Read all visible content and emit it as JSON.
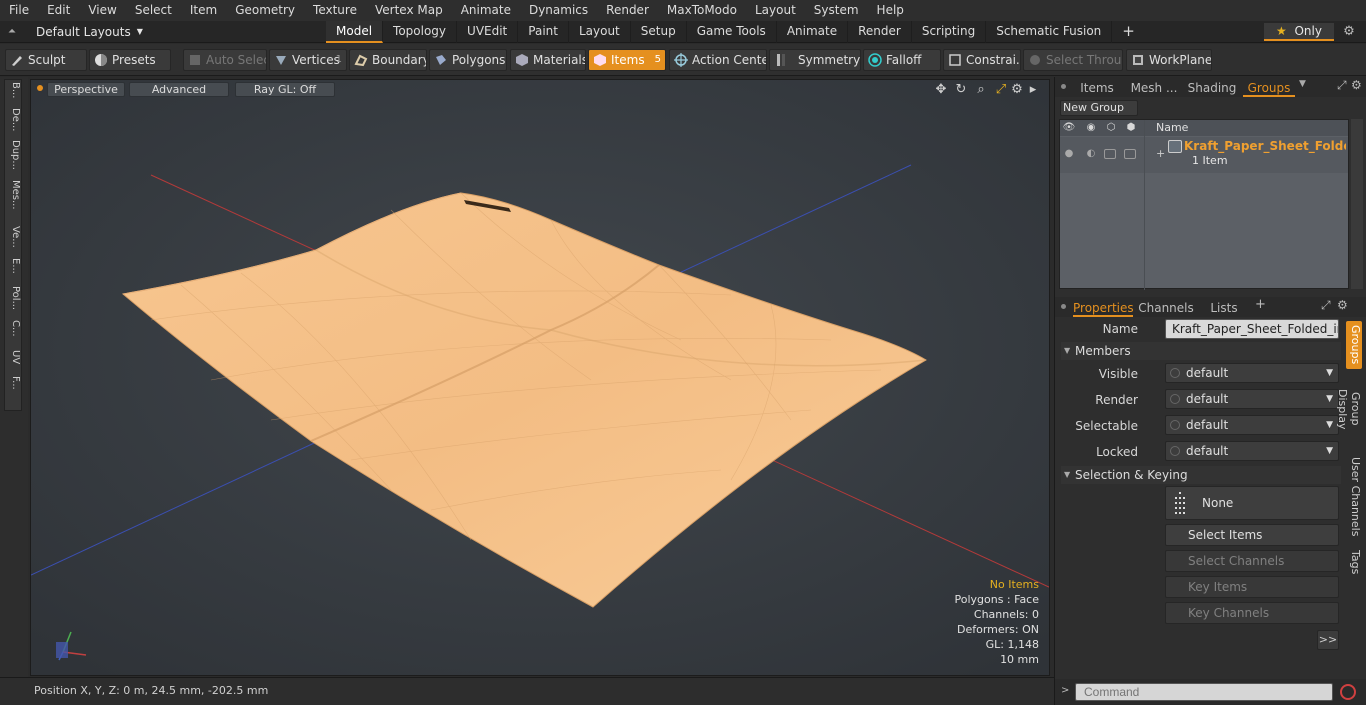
{
  "menu": [
    "File",
    "Edit",
    "View",
    "Select",
    "Item",
    "Geometry",
    "Texture",
    "Vertex Map",
    "Animate",
    "Dynamics",
    "Render",
    "MaxToModo",
    "Layout",
    "System",
    "Help"
  ],
  "layout_select": "Default Layouts",
  "layout_tabs": [
    "Model",
    "Topology",
    "UVEdit",
    "Paint",
    "Layout",
    "Setup",
    "Game Tools",
    "Animate",
    "Render",
    "Scripting",
    "Schematic Fusion"
  ],
  "layout_active": "Model",
  "add_tab": "+",
  "only_label": "Only",
  "toolbar": {
    "sculpt": "Sculpt",
    "presets": "Presets",
    "auto_select": "Auto Select",
    "vertices": "Vertices",
    "vertices_count": "1",
    "boundary": "Boundary",
    "polygons": "Polygons",
    "materials": "Materials",
    "items": "Items",
    "items_count": "5",
    "action_center": "Action Center",
    "symmetry": "Symmetry",
    "falloff": "Falloff",
    "constraints": "Constrai...",
    "select_through": "Select Through",
    "workplane": "WorkPlane"
  },
  "left_tabs": [
    "B...",
    "De...",
    "Dup...",
    "Mes...",
    "Ve...",
    "E...",
    "Pol...",
    "C...",
    "UV",
    "F..."
  ],
  "viewport": {
    "perspective": "Perspective",
    "advanced": "Advanced",
    "raygl": "Ray GL: Off",
    "stats": {
      "no_items": "No Items",
      "polygons": "Polygons : Face",
      "channels": "Channels: 0",
      "deformers": "Deformers: ON",
      "gl": "GL: 1,148",
      "scale": "10 mm"
    }
  },
  "status": {
    "position": "Position X, Y, Z:   0 m, 24.5 mm, -202.5 mm"
  },
  "right_top_tabs": [
    "Items",
    "Mesh ...",
    "Shading",
    "Groups"
  ],
  "right_top_active": "Groups",
  "new_group": "New Group",
  "groups_table": {
    "name_header": "Name",
    "group_name": "Kraft_Paper_Sheet_Folde ...",
    "group_count": "1 Item"
  },
  "props_tabs": [
    "Properties",
    "Channels",
    "Lists"
  ],
  "props_active": "Properties",
  "props": {
    "name_label": "Name",
    "name_value": "Kraft_Paper_Sheet_Folded_in_Fc",
    "members_section": "Members",
    "visible_label": "Visible",
    "visible_value": "default",
    "render_label": "Render",
    "render_value": "default",
    "selectable_label": "Selectable",
    "selectable_value": "default",
    "locked_label": "Locked",
    "locked_value": "default",
    "selkey_section": "Selection & Keying",
    "none_label": "None",
    "select_items": "Select Items",
    "select_channels": "Select Channels",
    "key_items": "Key Items",
    "key_channels": "Key Channels",
    "more": ">>"
  },
  "right_vert_tabs": [
    "Groups",
    "Group Display",
    "User Channels",
    "Tags"
  ],
  "command_placeholder": "Command",
  "colors": {
    "accent": "#e5901f",
    "paper": "#f5c28a",
    "viewport_bg": "#3a3f44"
  }
}
